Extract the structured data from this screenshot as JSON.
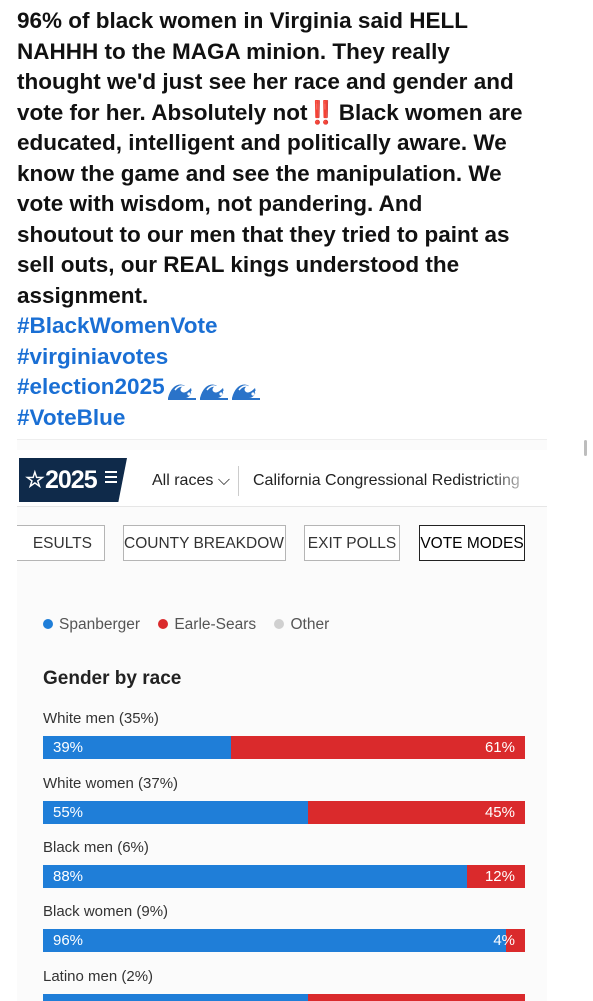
{
  "post": {
    "lines": [
      "96% of black women in Virginia said HELL",
      "NAHHH to the MAGA minion. They really",
      "thought we'd just see her race and gender and",
      "vote for her. Absolutely not",
      " Black women are",
      "educated, intelligent and politically aware. We",
      "know the game and see the manipulation. We",
      "vote with wisdom, not pandering. And",
      "shoutout to our men that they tried to paint as",
      "sell outs, our REAL kings understood the",
      "assignment."
    ],
    "bangbang": "‼️",
    "hashtags": [
      "#BlackWomenVote",
      "#virginiavotes",
      "#election2025",
      "#VoteBlue"
    ],
    "wave_emoji_count": 3
  },
  "screenshot": {
    "logo": {
      "star": "☆",
      "year": "2025"
    },
    "nav": {
      "all_races": "All races",
      "chevron": "⌵",
      "race": "California Congressional Redistricting"
    },
    "tabs": [
      "ESULTS",
      "COUNTY BREAKDOWN",
      "EXIT POLLS",
      "VOTE MODES"
    ],
    "active_tab": "VOTE MODES",
    "legend": [
      {
        "name": "Spanberger",
        "color": "#1f7ed8"
      },
      {
        "name": "Earle-Sears",
        "color": "#da2a2c"
      },
      {
        "name": "Other",
        "color": "#d0d0d0"
      }
    ],
    "section_title": "Gender by race",
    "groups": [
      {
        "label": "White men (35%)",
        "spanberger": 39,
        "earle_sears": 61,
        "spanberger_label": "39%",
        "earle_sears_label": "61%"
      },
      {
        "label": "White women (37%)",
        "spanberger": 55,
        "earle_sears": 45,
        "spanberger_label": "55%",
        "earle_sears_label": "45%"
      },
      {
        "label": "Black men (6%)",
        "spanberger": 88,
        "earle_sears": 12,
        "spanberger_label": "88%",
        "earle_sears_label": "12%"
      },
      {
        "label": "Black women (9%)",
        "spanberger": 96,
        "earle_sears": 4,
        "spanberger_label": "96%",
        "earle_sears_label": "4%"
      },
      {
        "label": "Latino men (2%)",
        "spanberger": 55,
        "earle_sears": 45,
        "spanberger_label": "",
        "earle_sears_label": ""
      }
    ],
    "colors": {
      "spanberger": "#1f7ed8",
      "earle_sears": "#da2a2c",
      "logo_bg": "#0f2a4a",
      "hashtag": "#1a6fd4"
    }
  }
}
